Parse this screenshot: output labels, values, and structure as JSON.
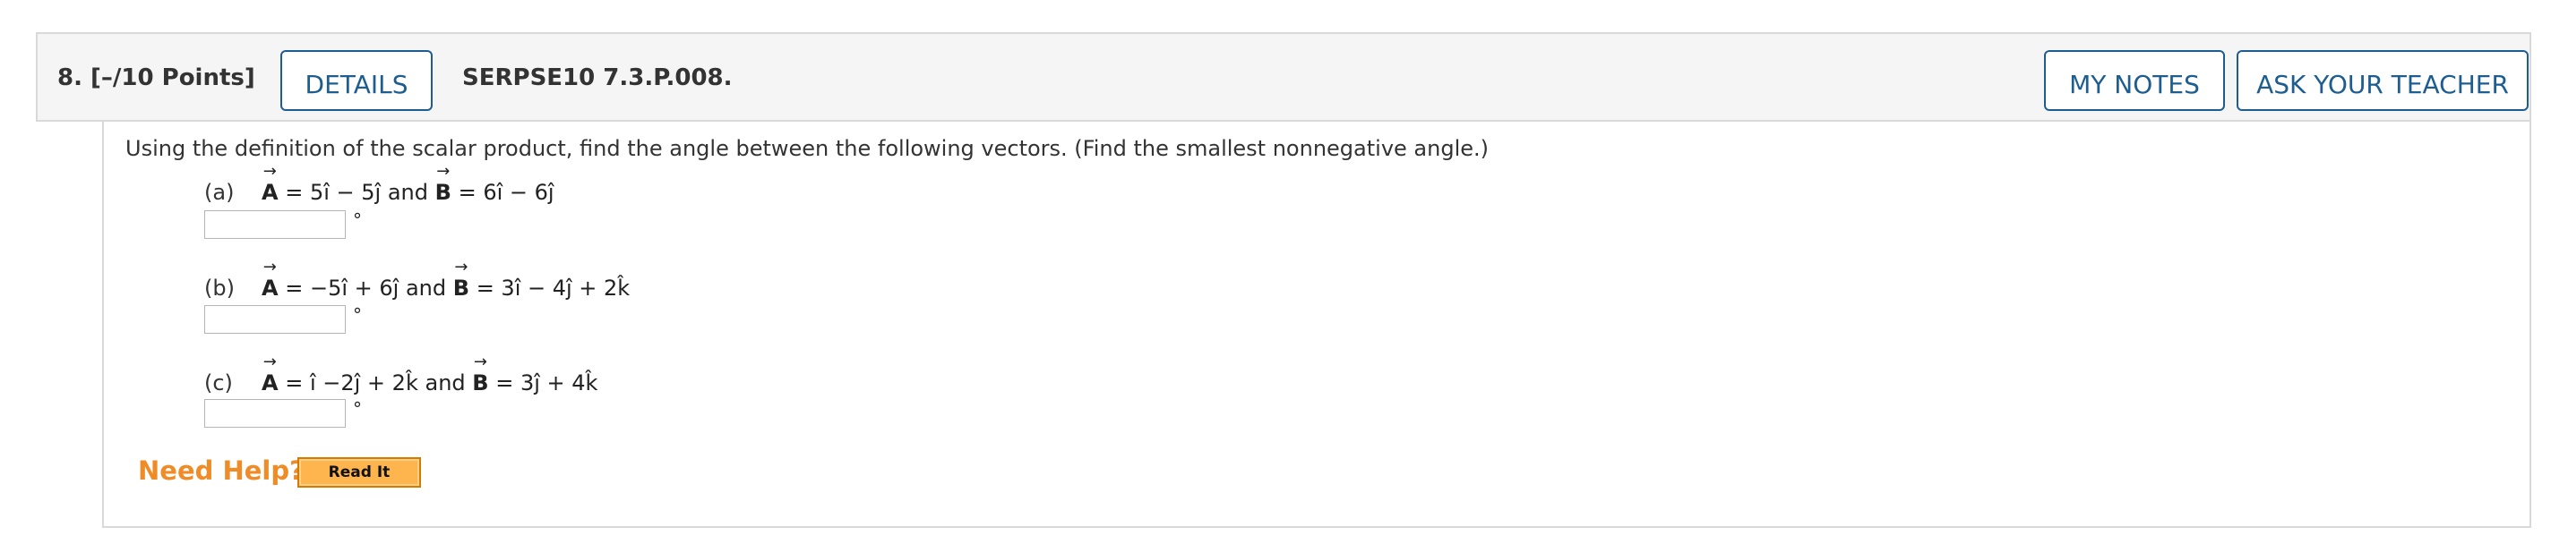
{
  "question": {
    "number": "8.",
    "points": "[–/10 Points]",
    "code": "SERPSE10 7.3.P.008."
  },
  "buttons": {
    "details": "DETAILS",
    "my_notes": "MY NOTES",
    "ask_teacher": "ASK YOUR TEACHER"
  },
  "prompt": "Using the definition of the scalar product, find the angle between the following vectors. (Find the smallest nonnegative angle.)",
  "parts": [
    {
      "label": "(a)",
      "a_expr": "= 5î − 5ĵ",
      "conj": "and",
      "b_expr": "= 6î − 6ĵ",
      "answer": "",
      "unit": "°"
    },
    {
      "label": "(b)",
      "a_expr": "= −5î + 6ĵ",
      "conj": "and",
      "b_expr": "= 3î − 4ĵ + 2k̂",
      "answer": "",
      "unit": "°"
    },
    {
      "label": "(c)",
      "a_expr": "= î −2ĵ + 2k̂",
      "conj": "and",
      "b_expr": "= 3ĵ + 4k̂",
      "answer": "",
      "unit": "°"
    }
  ],
  "vectors": {
    "a": "A",
    "b": "B"
  },
  "help": {
    "need_help": "Need Help?",
    "read_it": "Read It"
  }
}
